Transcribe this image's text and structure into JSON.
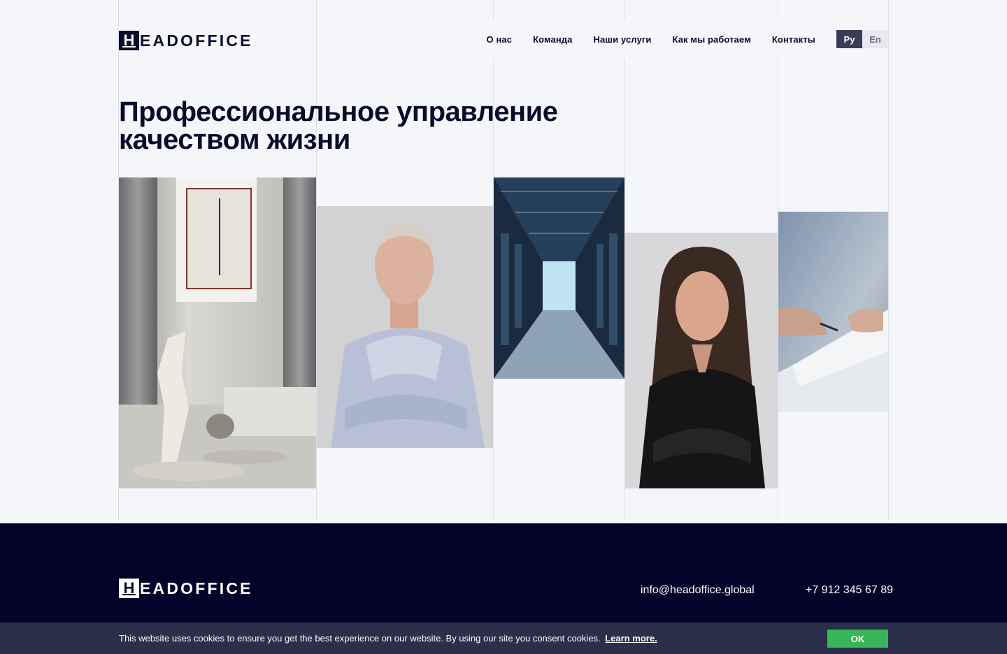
{
  "brand": {
    "logo_letter": "H",
    "logo_text": "EADOFFICE"
  },
  "nav": {
    "items": [
      {
        "label": "О нас"
      },
      {
        "label": "Команда"
      },
      {
        "label": "Наши услуги"
      },
      {
        "label": "Как мы работаем"
      },
      {
        "label": "Контакты"
      }
    ],
    "languages": [
      {
        "label": "Ру",
        "active": true
      },
      {
        "label": "En",
        "active": false
      }
    ]
  },
  "hero": {
    "title_line1": "Профессиональное управление",
    "title_line2": "качеством жизни"
  },
  "footer": {
    "email": "info@headoffice.global",
    "phone": "+7 912 345 67 89"
  },
  "cookie": {
    "text": "This website uses cookies to ensure you get the best experience on our website. By using our site you consent cookies.",
    "link": "Learn more.",
    "button": "OK"
  },
  "colors": {
    "background": "#f5f6fa",
    "primary_dark": "#0b0b2b",
    "footer_bg": "#03032a",
    "cookie_bg": "#2b2f49",
    "ok_green": "#37b558",
    "lang_active": "#3b3c57"
  }
}
